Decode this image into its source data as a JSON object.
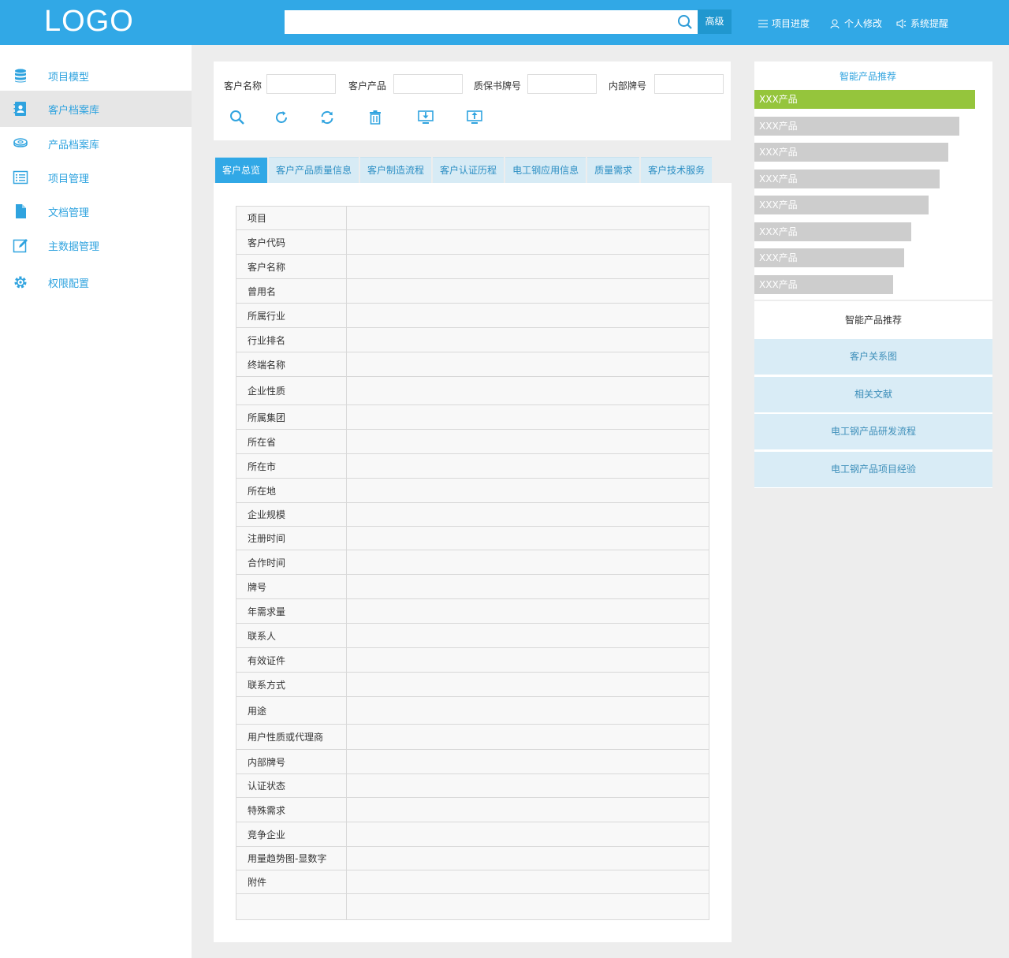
{
  "header": {
    "logo": "LOGO",
    "search_placeholder": "",
    "advanced_label": "高级",
    "nav": [
      "项目进度",
      "个人修改",
      "系统提醒"
    ]
  },
  "sidebar": {
    "items": [
      {
        "label": "项目模型",
        "icon": "database-icon"
      },
      {
        "label": "客户档案库",
        "icon": "contact-book-icon",
        "active": true
      },
      {
        "label": "产品档案库",
        "icon": "disk-stack-icon"
      },
      {
        "label": "项目管理",
        "icon": "list-icon"
      },
      {
        "label": "文档管理",
        "icon": "document-icon"
      },
      {
        "label": "主数据管理",
        "icon": "edit-icon"
      },
      {
        "label": "权限配置",
        "icon": "gear-icon"
      }
    ]
  },
  "filter": {
    "labels": [
      "客户名称",
      "客户产品",
      "质保书牌号",
      "内部牌号"
    ],
    "values": [
      "",
      "",
      "",
      ""
    ],
    "tools": [
      "search-icon",
      "refresh-icon",
      "sync-icon",
      "trash-icon",
      "download-icon",
      "upload-icon"
    ]
  },
  "tabs": [
    "客户总览",
    "客户产品质量信息",
    "客户制造流程",
    "客户认证历程",
    "电工钢应用信息",
    "质量需求",
    "客户技术服务"
  ],
  "table": {
    "rows": [
      "项目",
      "客户代码",
      "客户名称",
      "曾用名",
      "所属行业",
      "行业排名",
      "终端名称",
      "企业性质",
      "所属集团",
      "所在省",
      "所在市",
      "所在地",
      "企业规模",
      "注册时间",
      "合作时间",
      "牌号",
      "年需求量",
      "联系人",
      "有效证件",
      "联系方式",
      "用途",
      "用户性质或代理商",
      "内部牌号",
      "认证状态",
      "特殊需求",
      "竞争企业",
      "用量趋势图-显数字",
      "附件",
      ""
    ]
  },
  "recommend": {
    "title": "智能产品推荐",
    "products": [
      {
        "label": "XXX产品",
        "score": 1.0
      },
      {
        "label": "XXX产品",
        "score": 0.93
      },
      {
        "label": "XXX产品",
        "score": 0.88
      },
      {
        "label": "XXX产品",
        "score": 0.84
      },
      {
        "label": "XXX产品",
        "score": 0.79
      },
      {
        "label": "XXX产品",
        "score": 0.71
      },
      {
        "label": "XXX产品",
        "score": 0.68
      },
      {
        "label": "XXX产品",
        "score": 0.63
      }
    ],
    "title2": "智能产品推荐",
    "links": [
      "客户关系图",
      "相关文献",
      "电工钢产品研发流程",
      "电工钢产品项目经验"
    ]
  },
  "colors": {
    "accent": "#31a8e6",
    "highlight": "#95c53c",
    "bar": "#cdcdcd"
  }
}
